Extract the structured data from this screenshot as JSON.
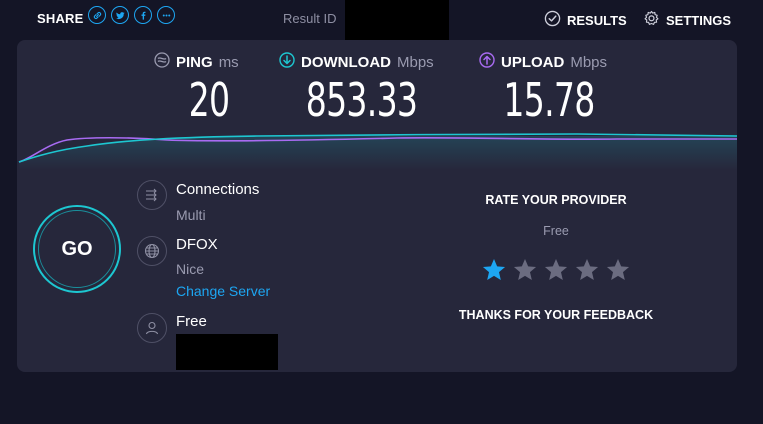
{
  "header": {
    "share_label": "SHARE",
    "share_icons": [
      "link-icon",
      "twitter-icon",
      "facebook-icon",
      "more-icon"
    ],
    "result_id_label": "Result ID",
    "results_label": "RESULTS",
    "settings_label": "SETTINGS"
  },
  "metrics": {
    "ping": {
      "label": "PING",
      "unit": "ms",
      "value": "20"
    },
    "download": {
      "label": "DOWNLOAD",
      "unit": "Mbps",
      "value": "853.33"
    },
    "upload": {
      "label": "UPLOAD",
      "unit": "Mbps",
      "value": "15.78"
    }
  },
  "go_label": "GO",
  "connections": {
    "title": "Connections",
    "value": "Multi"
  },
  "server": {
    "name": "DFOX",
    "location": "Nice",
    "change_label": "Change Server"
  },
  "provider": {
    "name": "Free"
  },
  "rating": {
    "title": "RATE YOUR PROVIDER",
    "provider": "Free",
    "stars_total": 5,
    "stars_selected": 1,
    "thanks": "THANKS FOR YOUR FEEDBACK"
  },
  "colors": {
    "accent_blue": "#1da6f2",
    "download_cyan": "#1dc7d1",
    "upload_purple": "#a86bf2",
    "star_inactive": "#6b6c80"
  }
}
